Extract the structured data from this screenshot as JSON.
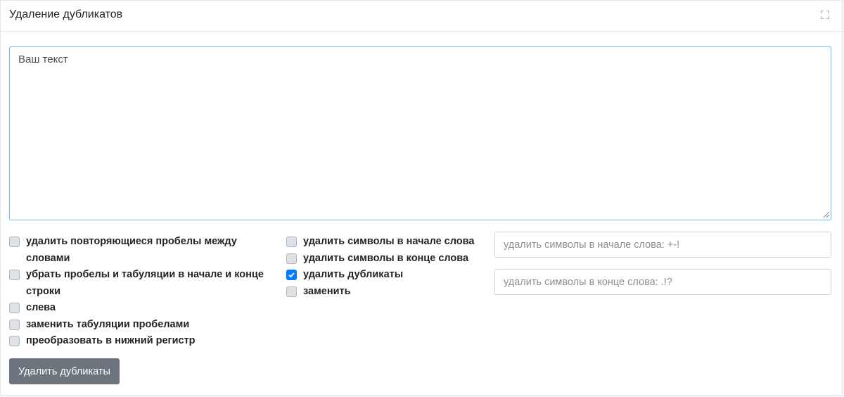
{
  "header": {
    "title": "Удаление дубликатов",
    "maximize_icon": "expand-icon"
  },
  "editor": {
    "placeholder": "Ваш текст",
    "value": ""
  },
  "options_left": [
    {
      "label": "удалить повторяющиеся пробелы между словами",
      "checked": false
    },
    {
      "label": "убрать пробелы и табуляции в начале и конце строки",
      "checked": false
    },
    {
      "label": "слева",
      "checked": false
    },
    {
      "label": "заменить табуляции пробелами",
      "checked": false
    },
    {
      "label": "преобразовать в нижний регистр",
      "checked": false
    }
  ],
  "options_mid": [
    {
      "label": "удалить символы в начале слова",
      "checked": false
    },
    {
      "label": "удалить символы в конце слова",
      "checked": false
    },
    {
      "label": "удалить дубликаты",
      "checked": true
    },
    {
      "label": "заменить",
      "checked": false
    }
  ],
  "inputs": {
    "start_chars_placeholder": "удалить символы в начале слова: +-!",
    "end_chars_placeholder": "удалить символы в конце слова: .!?"
  },
  "actions": {
    "submit_label": "Удалить дубликаты"
  },
  "colors": {
    "accent": "#007bff",
    "button": "#6c757d",
    "focus_border": "#80bdff"
  }
}
